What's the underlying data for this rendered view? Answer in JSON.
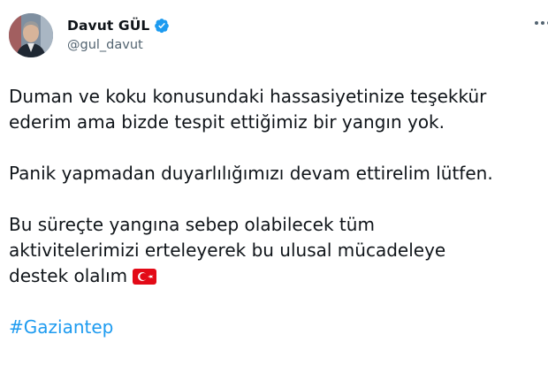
{
  "author": {
    "name": "Davut GÜL",
    "handle": "@gul_davut",
    "verified": true,
    "avatar": "profile-photo"
  },
  "tweet": {
    "lines": [
      "Duman ve koku konusundaki hassasiyetinize teşekkür",
      "ederim ama bizde tespit ettiğimiz bir yangın yok.",
      "Panik yapmadan duyarlılığımızı devam ettirelim lütfen.",
      "Bu süreçte yangına sebep olabilecek tüm",
      "aktivitelerimizi erteleyerek bu ulusal mücadeleye",
      "destek olalım"
    ],
    "flag_icon": "turkey-flag-icon",
    "hashtag": "#Gaziantep"
  },
  "colors": {
    "text": "#0f1419",
    "secondary": "#536471",
    "link": "#1d9bf0",
    "verified": "#1d9bf0"
  }
}
